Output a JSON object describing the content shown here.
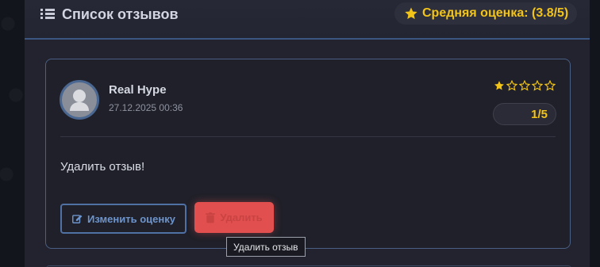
{
  "header": {
    "title": "Список отзывов",
    "list_icon": "list-icon",
    "average_label": "Средняя оценка: (3.8/5)",
    "star_icon": "star-icon"
  },
  "review": {
    "user_name": "Real Hype",
    "date": "27.12.2025 00:36",
    "avatar_icon": "user-silhouette-icon",
    "rating": 1,
    "max_rating": 5,
    "score_label": "1/5",
    "text": "Удалить отзыв!",
    "edit_label": "Изменить оценку",
    "edit_icon": "edit-icon",
    "delete_label": "Удалить",
    "delete_icon": "trash-icon"
  },
  "tooltip": {
    "text": "Удалить отзыв"
  },
  "colors": {
    "accent_gold": "#f2c41a",
    "accent_blue": "#4f71a4",
    "danger": "#e14f4f"
  }
}
